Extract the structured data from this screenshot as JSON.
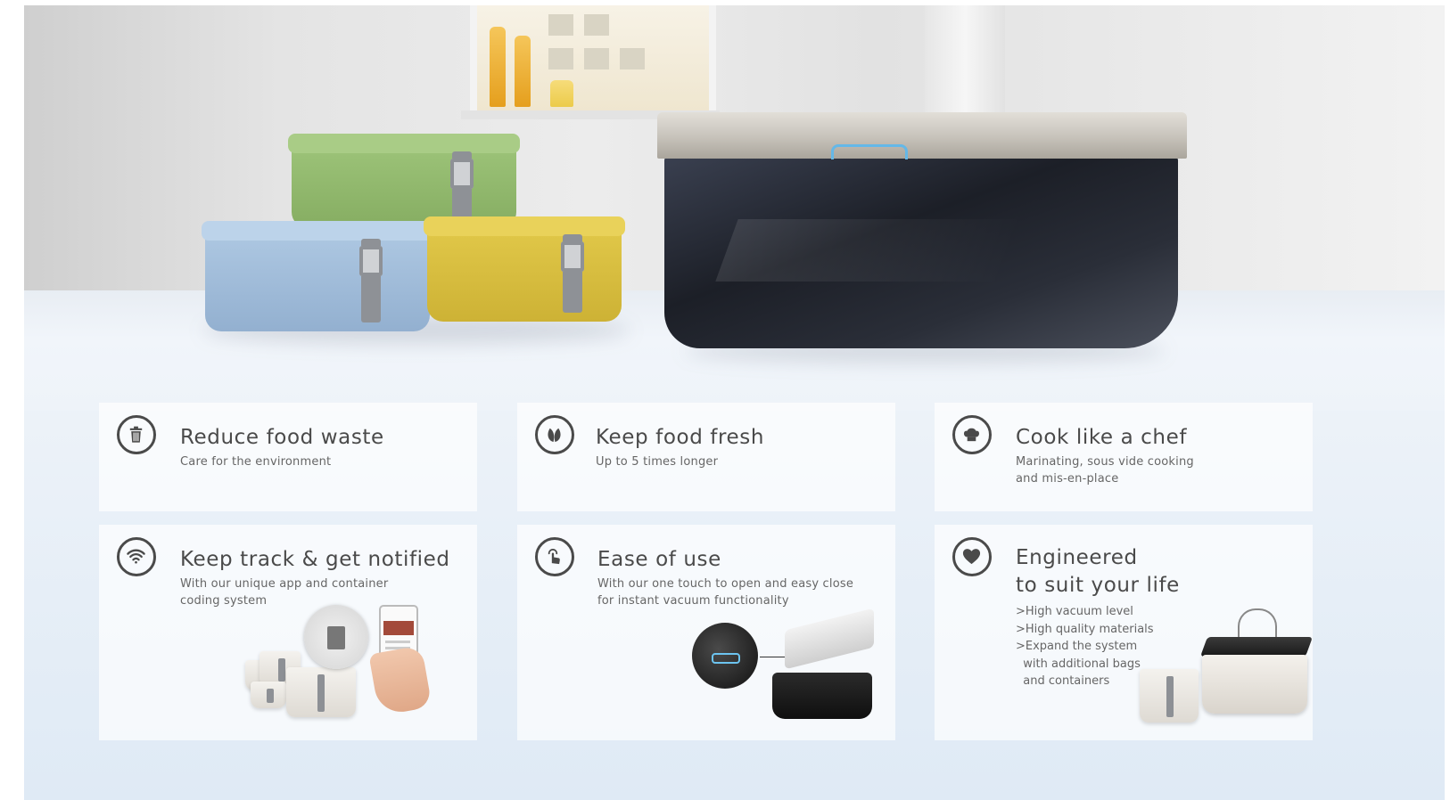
{
  "features": [
    {
      "title": "Reduce food waste",
      "subtitle": [
        "Care for the environment"
      ],
      "icon": "trash-icon"
    },
    {
      "title": "Keep food fresh",
      "subtitle": [
        "Up to 5 times longer"
      ],
      "icon": "leaf-icon"
    },
    {
      "title": "Cook like a chef",
      "subtitle": [
        "Marinating, sous vide cooking",
        "and mis-en-place"
      ],
      "icon": "chef-hat-icon"
    },
    {
      "title": "Keep track & get notified",
      "subtitle": [
        "With our unique app and container",
        "coding system"
      ],
      "icon": "wifi-icon"
    },
    {
      "title": "Ease of use",
      "subtitle": [
        "With our one touch to open and easy close",
        "for instant vacuum functionality"
      ],
      "icon": "touch-icon"
    },
    {
      "title": [
        "Engineered",
        "to suit your life"
      ],
      "bullets": [
        ">High vacuum level",
        ">High quality materials",
        ">Expand the system",
        "  with additional bags",
        "  and containers"
      ],
      "icon": "heart-icon"
    }
  ],
  "colors": {
    "icon": "#4a4a4a",
    "card": "#ffffff",
    "background": "#e4edf6",
    "vacuum_button": "#64b8e8"
  }
}
